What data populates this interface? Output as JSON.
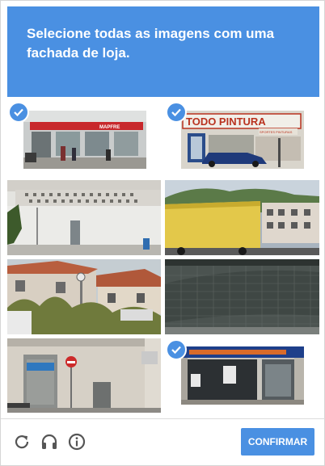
{
  "header": {
    "line1": "Selecione todas as imagens com uma",
    "line2_bold": "fachada de loja",
    "line2_end": "."
  },
  "tiles": [
    {
      "name": "tile-1",
      "selected": true,
      "sign": "MAPFRE"
    },
    {
      "name": "tile-2",
      "selected": true,
      "sign": "TODO PINTURA",
      "subsign": "SPORTES PINTURAS"
    },
    {
      "name": "tile-3",
      "selected": false
    },
    {
      "name": "tile-4",
      "selected": false
    },
    {
      "name": "tile-5",
      "selected": false
    },
    {
      "name": "tile-6",
      "selected": false
    },
    {
      "name": "tile-7",
      "selected": false
    },
    {
      "name": "tile-8",
      "selected": true
    }
  ],
  "footer": {
    "reload_icon": "reload-icon",
    "audio_icon": "headphones-icon",
    "info_icon": "info-icon",
    "confirm_label": "CONFIRMAR"
  },
  "colors": {
    "accent": "#4a90e2"
  }
}
